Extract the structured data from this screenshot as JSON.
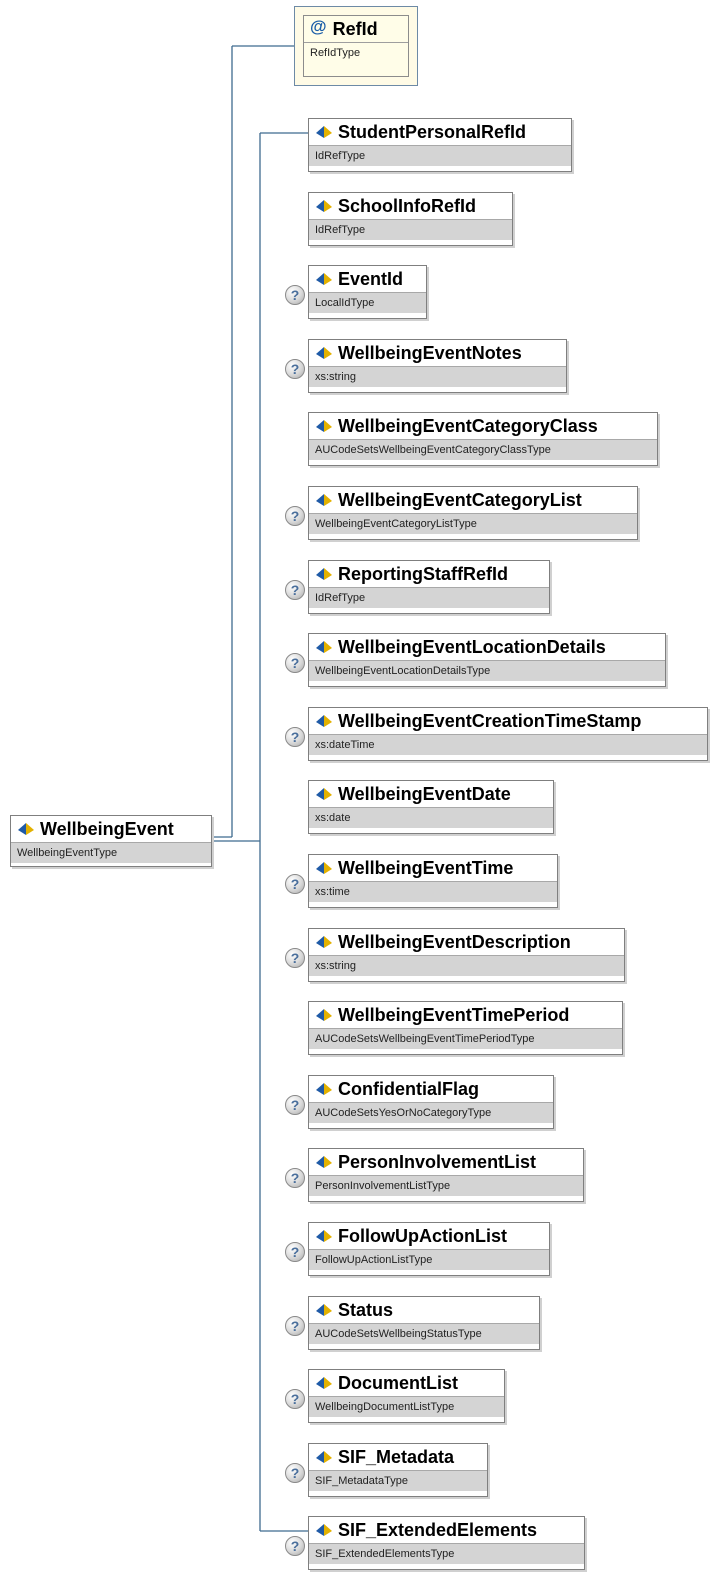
{
  "root": {
    "name": "WellbeingEvent",
    "type": "WellbeingEventType"
  },
  "attribute": {
    "symbol": "@",
    "name": "RefId",
    "type": "RefIdType"
  },
  "optional_marker": "?",
  "children": [
    {
      "name": "StudentPersonalRefId",
      "type": "IdRefType",
      "optional": false
    },
    {
      "name": "SchoolInfoRefId",
      "type": "IdRefType",
      "optional": false
    },
    {
      "name": "EventId",
      "type": "LocalIdType",
      "optional": true
    },
    {
      "name": "WellbeingEventNotes",
      "type": "xs:string",
      "optional": true
    },
    {
      "name": "WellbeingEventCategoryClass",
      "type": "AUCodeSetsWellbeingEventCategoryClassType",
      "optional": false
    },
    {
      "name": "WellbeingEventCategoryList",
      "type": "WellbeingEventCategoryListType",
      "optional": true
    },
    {
      "name": "ReportingStaffRefId",
      "type": "IdRefType",
      "optional": true
    },
    {
      "name": "WellbeingEventLocationDetails",
      "type": "WellbeingEventLocationDetailsType",
      "optional": true
    },
    {
      "name": "WellbeingEventCreationTimeStamp",
      "type": "xs:dateTime",
      "optional": true
    },
    {
      "name": "WellbeingEventDate",
      "type": "xs:date",
      "optional": false
    },
    {
      "name": "WellbeingEventTime",
      "type": "xs:time",
      "optional": true
    },
    {
      "name": "WellbeingEventDescription",
      "type": "xs:string",
      "optional": true
    },
    {
      "name": "WellbeingEventTimePeriod",
      "type": "AUCodeSetsWellbeingEventTimePeriodType",
      "optional": false
    },
    {
      "name": "ConfidentialFlag",
      "type": "AUCodeSetsYesOrNoCategoryType",
      "optional": true
    },
    {
      "name": "PersonInvolvementList",
      "type": "PersonInvolvementListType",
      "optional": true
    },
    {
      "name": "FollowUpActionList",
      "type": "FollowUpActionListType",
      "optional": true
    },
    {
      "name": "Status",
      "type": "AUCodeSetsWellbeingStatusType",
      "optional": true
    },
    {
      "name": "DocumentList",
      "type": "WellbeingDocumentListType",
      "optional": true
    },
    {
      "name": "SIF_Metadata",
      "type": "SIF_MetadataType",
      "optional": true
    },
    {
      "name": "SIF_ExtendedElements",
      "type": "SIF_ExtendedElementsType",
      "optional": true
    }
  ],
  "colors": {
    "connector": "#3f6b8f",
    "type_band": "#d4d4d4",
    "icon_blue": "#1f5aa6",
    "icon_gold": "#e3b100"
  }
}
